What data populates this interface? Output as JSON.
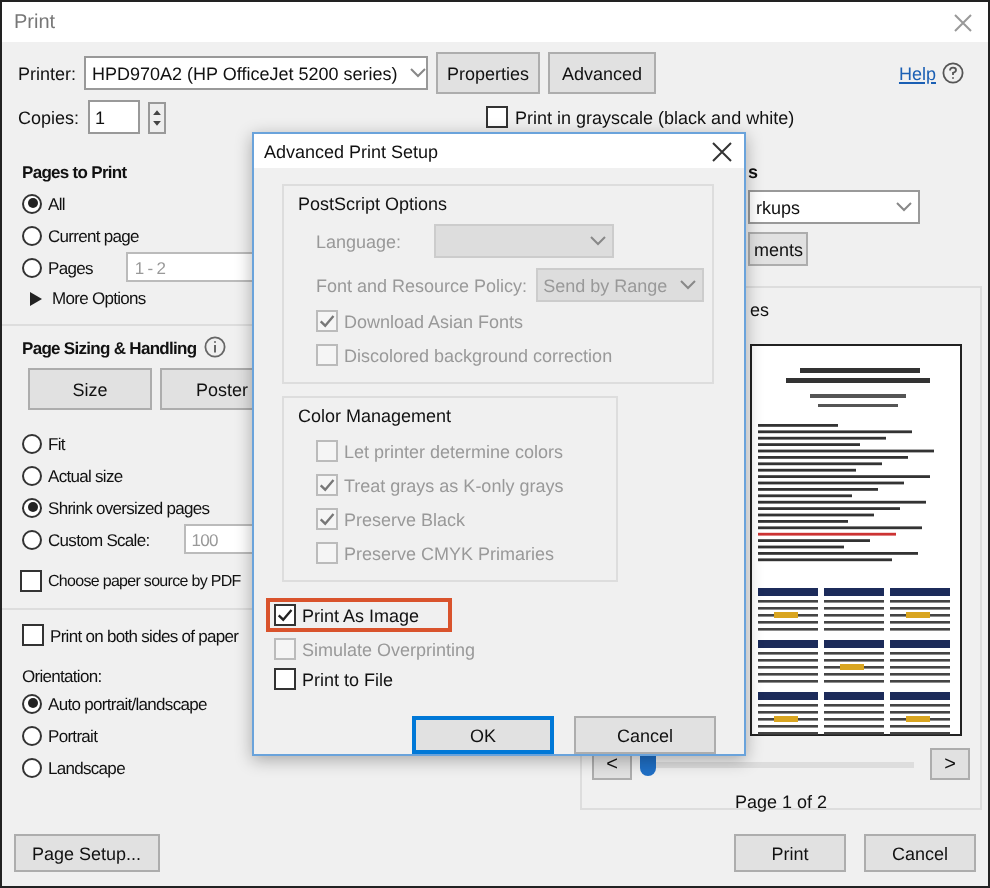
{
  "window": {
    "title": "Print"
  },
  "printer": {
    "label": "Printer:",
    "value": "HPD970A2 (HP OfficeJet 5200 series)"
  },
  "top_buttons": [
    "Properties",
    "Advanced"
  ],
  "help": {
    "label": "Help"
  },
  "copies": {
    "label": "Copies:",
    "value": "1"
  },
  "grayscale": {
    "label": "Print in grayscale (black and white)",
    "checked": false
  },
  "pages_to_print": {
    "title": "Pages to Print",
    "options": [
      {
        "label": "All",
        "selected": true
      },
      {
        "label": "Current page",
        "selected": false
      },
      {
        "label": "Pages",
        "selected": false,
        "value": "1 - 2"
      }
    ],
    "more_options": "More Options"
  },
  "page_sizing": {
    "title": "Page Sizing & Handling",
    "buttons": [
      "Size",
      "Poster"
    ],
    "options": [
      {
        "label": "Fit",
        "selected": false
      },
      {
        "label": "Actual size",
        "selected": false
      },
      {
        "label": "Shrink oversized pages",
        "selected": true
      },
      {
        "label": "Custom Scale:",
        "selected": false,
        "value": "100"
      }
    ],
    "paper_source": {
      "label": "Choose paper source by PDF",
      "checked": false
    }
  },
  "both_sides": {
    "label": "Print on both sides of paper",
    "checked": false
  },
  "orientation": {
    "title": "Orientation:",
    "options": [
      {
        "label": "Auto portrait/landscape",
        "selected": true
      },
      {
        "label": "Portrait",
        "selected": false
      },
      {
        "label": "Landscape",
        "selected": false
      }
    ]
  },
  "page_setup_button": "Page Setup...",
  "comments": {
    "heading": "s",
    "dropdown": "rkups",
    "button": "ments"
  },
  "preview": {
    "heading": "es",
    "prev": "<",
    "next": ">",
    "slider": {
      "level": 0
    },
    "page_label": "Page 1 of 2"
  },
  "footer_buttons": [
    "Print",
    "Cancel"
  ],
  "advanced_dialog": {
    "title": "Advanced Print Setup",
    "postscript": {
      "title": "PostScript Options",
      "language": {
        "label": "Language:",
        "disabled": true
      },
      "font_policy": {
        "label": "Font and Resource Policy:",
        "value": "Send by Range",
        "disabled": true
      },
      "checks": [
        {
          "label": "Download Asian Fonts",
          "checked": true,
          "disabled": true
        },
        {
          "label": "Discolored background correction",
          "checked": false,
          "disabled": true
        }
      ]
    },
    "color_management": {
      "title": "Color Management",
      "checks": [
        {
          "label": "Let printer determine colors",
          "checked": false,
          "disabled": true
        },
        {
          "label": "Treat grays as K-only grays",
          "checked": true,
          "disabled": true
        },
        {
          "label": "Preserve Black",
          "checked": true,
          "disabled": true
        },
        {
          "label": "Preserve CMYK Primaries",
          "checked": false,
          "disabled": true
        }
      ]
    },
    "checks": [
      {
        "label": "Print As Image",
        "checked": true,
        "disabled": false,
        "highlighted": true
      },
      {
        "label": "Simulate Overprinting",
        "checked": false,
        "disabled": true,
        "highlighted": false
      },
      {
        "label": "Print to File",
        "checked": false,
        "disabled": false,
        "highlighted": false
      }
    ],
    "buttons": [
      {
        "label": "OK",
        "default": true
      },
      {
        "label": "Cancel",
        "default": false
      }
    ]
  }
}
